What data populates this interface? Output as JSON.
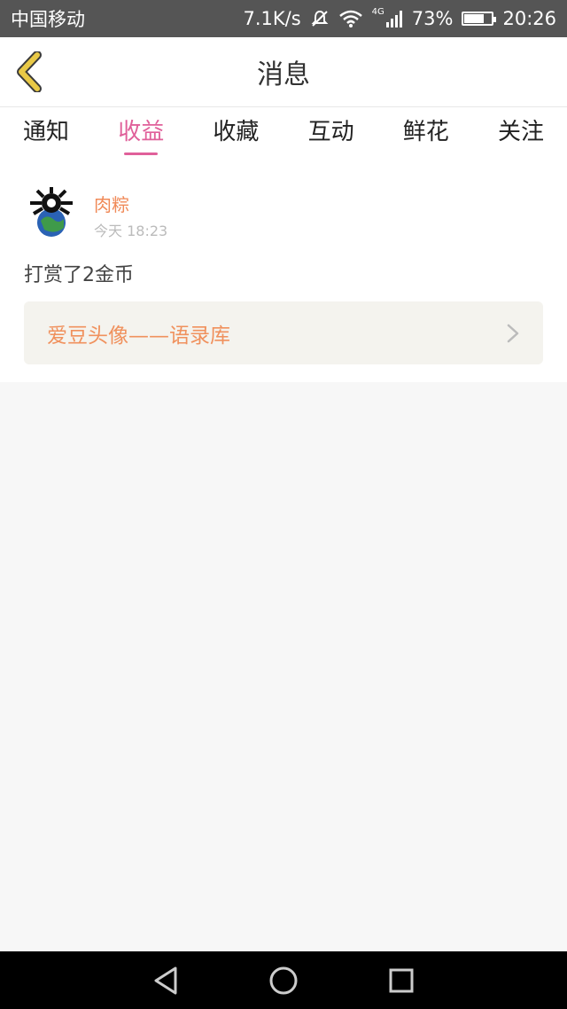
{
  "status_bar": {
    "carrier": "中国移动",
    "speed": "7.1K/s",
    "network": "4G",
    "battery": "73%",
    "battery_level": 0.73,
    "time": "20:26"
  },
  "header": {
    "title": "消息"
  },
  "tabs": [
    {
      "label": "通知",
      "active": false
    },
    {
      "label": "收益",
      "active": true
    },
    {
      "label": "收藏",
      "active": false
    },
    {
      "label": "互动",
      "active": false
    },
    {
      "label": "鲜花",
      "active": false
    },
    {
      "label": "关注",
      "active": false
    }
  ],
  "message": {
    "username": "肉粽",
    "time": "今天 18:23",
    "text": "打赏了2金币",
    "link_text": "爱豆头像——语录库"
  },
  "colors": {
    "accent": "#e0609a",
    "username": "#f08a58",
    "link": "#f0915d",
    "back_arrow": "#e9c946"
  }
}
